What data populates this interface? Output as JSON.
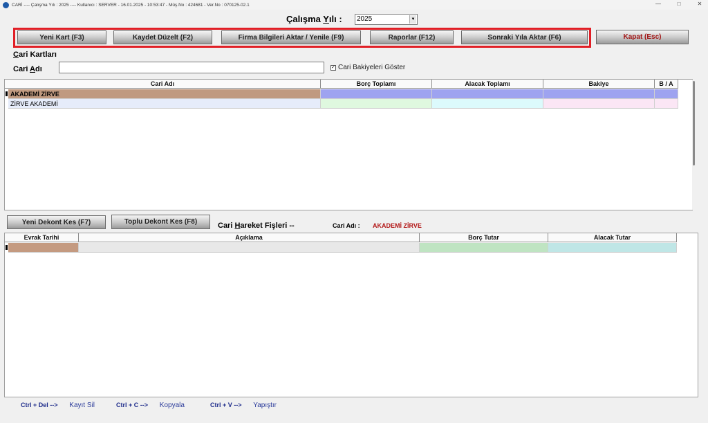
{
  "window": {
    "title": "CARİ  ----  Çalışma Yılı : 2025  ----  Kullanıcı : SERVER - 16.01.2025 - 10:53:47 - Müş.No : 424681 - Ver.No : 070125-02.1",
    "minimize": "—",
    "maximize": "□",
    "close": "✕"
  },
  "year": {
    "label_prefix": "Çalışma ",
    "label_underlined": "Y",
    "label_suffix": "ılı :",
    "value": "2025"
  },
  "toolbar": {
    "new_card": "Yeni Kart (F3)",
    "save_edit": "Kaydet Düzelt (F2)",
    "company_transfer": "Firma Bilgileri Aktar / Yenile (F9)",
    "reports": "Raporlar (F12)",
    "next_year": "Sonraki Yıla Aktar (F6)",
    "exit": "Kapat (Esc)"
  },
  "cards": {
    "section_title_underlined": "C",
    "section_title_rest": "ari Kartları",
    "name_label_prefix": "Cari ",
    "name_label_underlined": "A",
    "name_label_rest": "dı",
    "name_value": "",
    "show_balances_label": "Cari Bakiyeleri Göster",
    "show_balances_checked": "✓",
    "columns": [
      "Cari Adı",
      "Borç Toplamı",
      "Alacak Toplamı",
      "Bakiye",
      "B / A"
    ],
    "rows": [
      {
        "name": "AKADEMİ ZİRVE",
        "debit": "",
        "credit": "",
        "balance": "",
        "ba": ""
      },
      {
        "name": "ZİRVE AKADEMİ",
        "debit": "",
        "credit": "",
        "balance": "",
        "ba": ""
      }
    ]
  },
  "movements": {
    "new_receipt": "Yeni Dekont Kes (F7)",
    "bulk_receipt": "Toplu Dekont Kes (F8)",
    "title_prefix": "Cari ",
    "title_underlined": "H",
    "title_rest": "areket Fişleri  --",
    "cari_label": "Cari Adı :",
    "cari_value": "AKADEMİ ZİRVE",
    "columns": [
      "Evrak Tarihi",
      "Açıklama",
      "Borç Tutar",
      "Alacak Tutar"
    ]
  },
  "shortcuts": [
    {
      "key": "Ctrl + Del -->",
      "action": "Kayıt Sil"
    },
    {
      "key": "Ctrl + C -->",
      "action": "Kopyala"
    },
    {
      "key": "Ctrl + V -->",
      "action": "Yapıştır"
    }
  ],
  "colors": {
    "toolbar_frame": "#e11f26",
    "row1_name": "#c09a80",
    "row1_rest": "#9ea3f0",
    "row2_name": "#e6ecfa",
    "row2_debit": "#dff8df",
    "row2_credit": "#dcfafc",
    "row2_balance": "#fbe6f5",
    "mov_date": "#c49a80",
    "mov_desc": "#e8e8e8",
    "mov_debit": "#bfe4c2",
    "mov_credit": "#bfe6e6",
    "cari_value": "#b31a1a"
  }
}
